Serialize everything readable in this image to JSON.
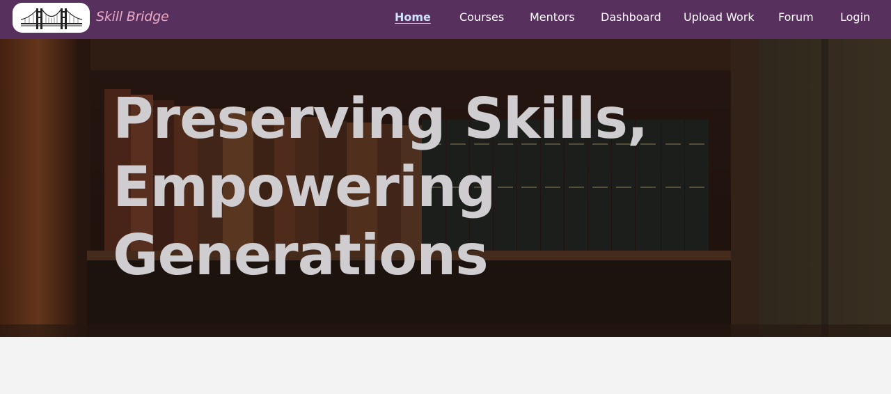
{
  "brand": {
    "name": "Skill Bridge",
    "logo_icon": "bridge-icon"
  },
  "nav": {
    "items": [
      {
        "label": "Home",
        "active": true
      },
      {
        "label": "Courses",
        "active": false
      },
      {
        "label": "Mentors",
        "active": false
      },
      {
        "label": "Dashboard",
        "active": false
      },
      {
        "label": "Upload Work",
        "active": false
      },
      {
        "label": "Forum",
        "active": false
      },
      {
        "label": "Login",
        "active": false
      }
    ]
  },
  "hero": {
    "title_lines": [
      "Preserving Skills,",
      "Empowering",
      "Generations"
    ]
  },
  "colors": {
    "navbar": "#57305e",
    "brand_text": "#e9a9c5",
    "active_link": "#cfe3ff",
    "hero_text": "#cfcdcf",
    "page_bg": "#f3f3f3"
  }
}
